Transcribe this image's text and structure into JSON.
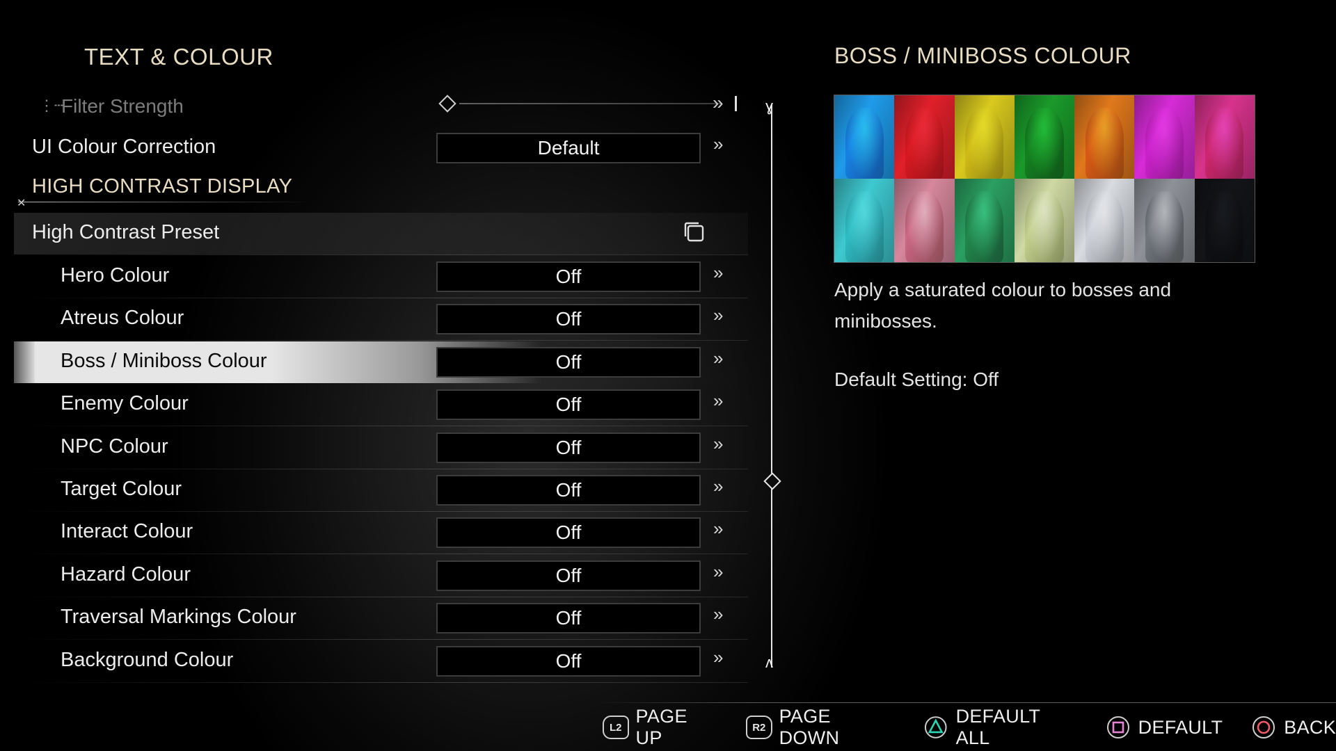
{
  "section_title": "TEXT & COLOUR",
  "filter": {
    "label": "Filter Strength",
    "level": 0
  },
  "ui_colour_correction": {
    "label": "UI Colour Correction",
    "value": "Default"
  },
  "hc_header": "HIGH CONTRAST DISPLAY",
  "preset": {
    "label": "High Contrast Preset"
  },
  "settings": [
    {
      "label": "Hero Colour",
      "value": "Off"
    },
    {
      "label": "Atreus Colour",
      "value": "Off"
    },
    {
      "label": "Boss / Miniboss Colour",
      "value": "Off"
    },
    {
      "label": "Enemy Colour",
      "value": "Off"
    },
    {
      "label": "NPC Colour",
      "value": "Off"
    },
    {
      "label": "Target Colour",
      "value": "Off"
    },
    {
      "label": "Interact Colour",
      "value": "Off"
    },
    {
      "label": "Hazard Colour",
      "value": "Off"
    },
    {
      "label": "Traversal Markings Colour",
      "value": "Off"
    },
    {
      "label": "Background Colour",
      "value": "Off"
    }
  ],
  "selected_index": 2,
  "panel": {
    "title": "BOSS / MINIBOSS COLOUR",
    "swatches": [
      "#1f9bea",
      "#e0202a",
      "#d9c91e",
      "#1a9a2a",
      "#e0781c",
      "#d62bd6",
      "#d8338c",
      "#3ec9d0",
      "#d6879c",
      "#2b9f61",
      "#cfd9a3",
      "#d8dbe0",
      "#8e9298",
      "#121418"
    ],
    "description": "Apply a saturated colour to bosses and minibosses.",
    "default_setting": "Default Setting: Off"
  },
  "footer": {
    "page_up": {
      "button": "L2",
      "label": "PAGE UP"
    },
    "page_down": {
      "button": "R2",
      "label": "PAGE DOWN"
    },
    "default_all": {
      "button": "triangle",
      "label": "DEFAULT ALL",
      "color": "#2bd6b4"
    },
    "default": {
      "button": "square",
      "label": "DEFAULT",
      "color": "#e684d6"
    },
    "back": {
      "button": "circle",
      "label": "BACK",
      "color": "#f05a6a"
    }
  },
  "icons": {
    "filter": "tree-branch-icon",
    "arrow": "double-chevron-right-icon",
    "preset": "copy-icon"
  }
}
